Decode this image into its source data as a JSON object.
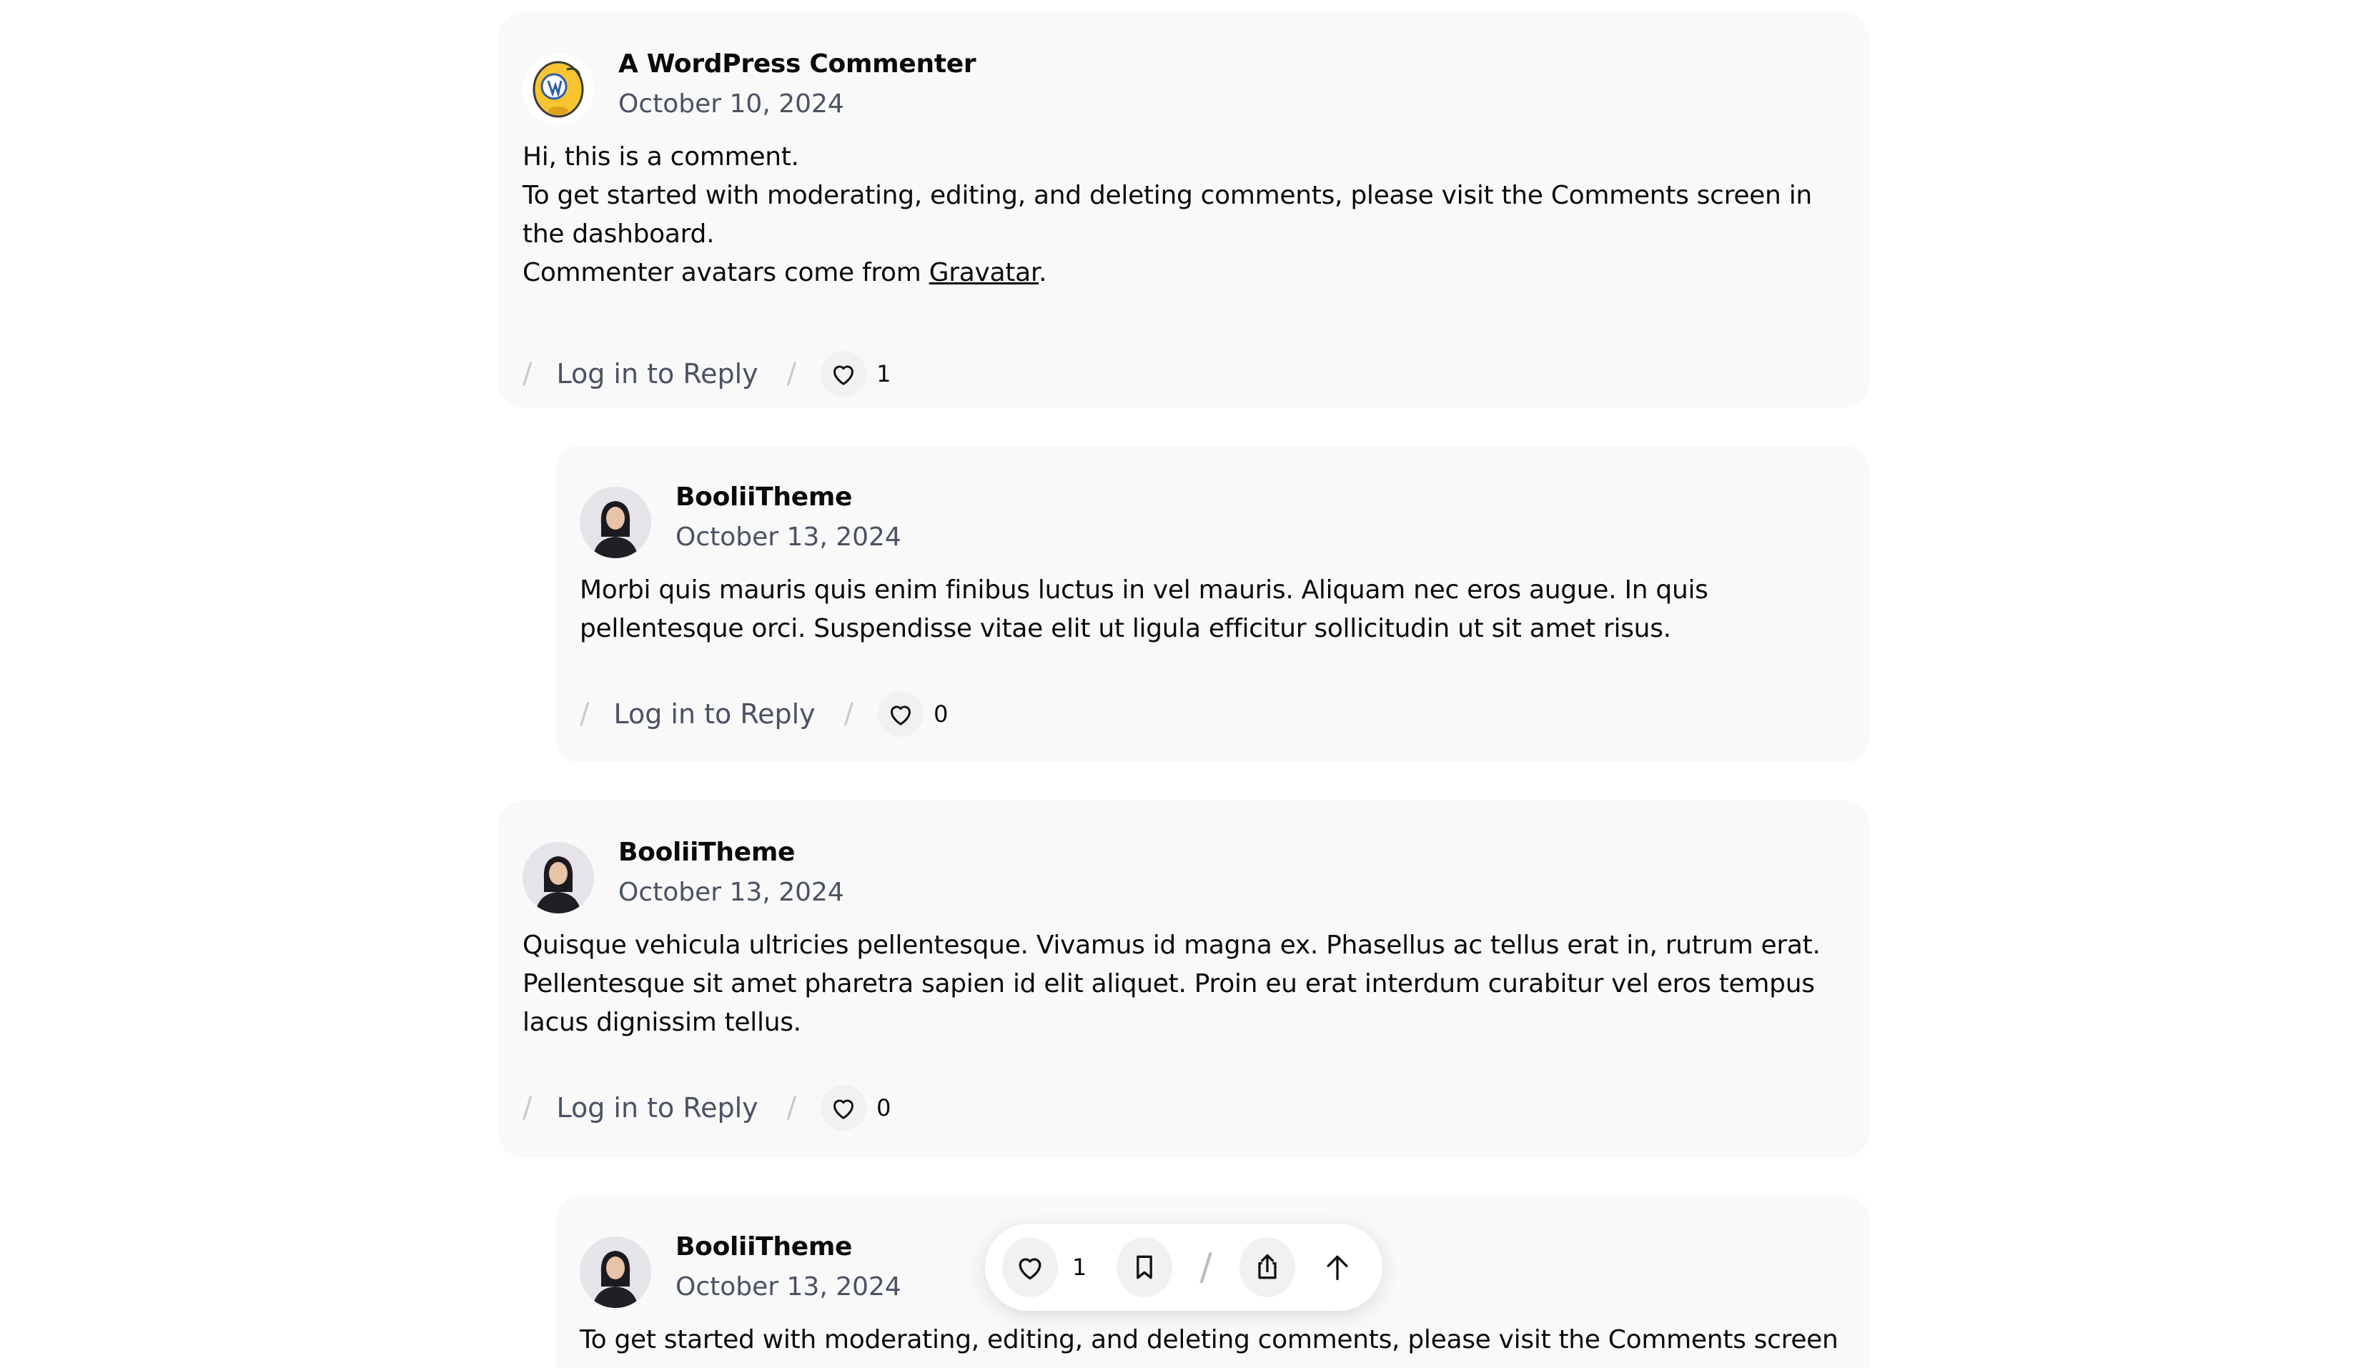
{
  "comments": [
    {
      "author": "A WordPress Commenter",
      "date": "October 10, 2024",
      "avatar": "wordpress-avatar",
      "lines": [
        "Hi, this is a comment.",
        "To get started with moderating, editing, and deleting comments, please visit the Comments screen in the dashboard."
      ],
      "avatars_prefix": "Commenter avatars come from ",
      "avatars_link": "Gravatar",
      "avatars_suffix": ".",
      "reply_label": "Log in to Reply",
      "likes": "1"
    },
    {
      "author": "BooliiTheme",
      "date": "October 13, 2024",
      "avatar": "woman-avatar",
      "text": "Morbi quis mauris quis enim finibus luctus in vel mauris. Aliquam nec eros augue. In quis pellentesque orci. Suspendisse vitae elit ut ligula efficitur sollicitudin ut sit amet risus.",
      "reply_label": "Log in to Reply",
      "likes": "0"
    },
    {
      "author": "BooliiTheme",
      "date": "October 13, 2024",
      "avatar": "woman-avatar",
      "text": "Quisque vehicula ultricies pellentesque. Vivamus id magna ex. Phasellus ac tellus erat in, rutrum erat. Pellentesque sit amet pharetra sapien id elit aliquet. Proin eu erat interdum curabitur vel eros tempus lacus dignissim tellus.",
      "reply_label": "Log in to Reply",
      "likes": "0"
    },
    {
      "author": "BooliiTheme",
      "date": "October 13, 2024",
      "avatar": "woman-avatar",
      "text": "To get started with moderating, editing, and deleting comments, please visit the Comments screen"
    }
  ],
  "separator": "/",
  "toolbar": {
    "likes": "1",
    "separator": "/",
    "icons": [
      "heart-icon",
      "bookmark-icon",
      "share-icon",
      "arrow-up-icon"
    ]
  },
  "colors": {
    "card_bg": "#f9f9f9",
    "meta_text": "#4a5264",
    "separator": "#c7c9cf"
  }
}
